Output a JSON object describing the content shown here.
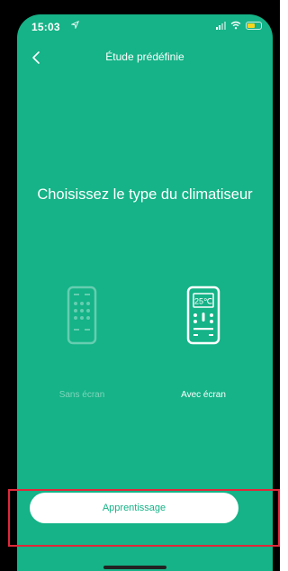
{
  "status": {
    "time": "15:03",
    "location_icon": "location-arrow-icon",
    "signal_icon": "signal-icon",
    "wifi_icon": "wifi-icon",
    "battery_icon": "battery-icon"
  },
  "nav": {
    "back_icon": "chevron-left-icon",
    "title": "Étude prédéfinie"
  },
  "main": {
    "heading": "Choisissez le type du climatiseur"
  },
  "options": [
    {
      "label": "Sans écran",
      "icon": "remote-no-screen-icon",
      "selected": false
    },
    {
      "label": "Avec écran",
      "icon": "remote-with-screen-icon",
      "selected": true,
      "display_text": "25℃"
    }
  ],
  "actions": {
    "learn_label": "Apprentissage"
  },
  "colors": {
    "primary": "#15b387",
    "highlight": "#e0283a",
    "battery": "#f7d51d"
  }
}
